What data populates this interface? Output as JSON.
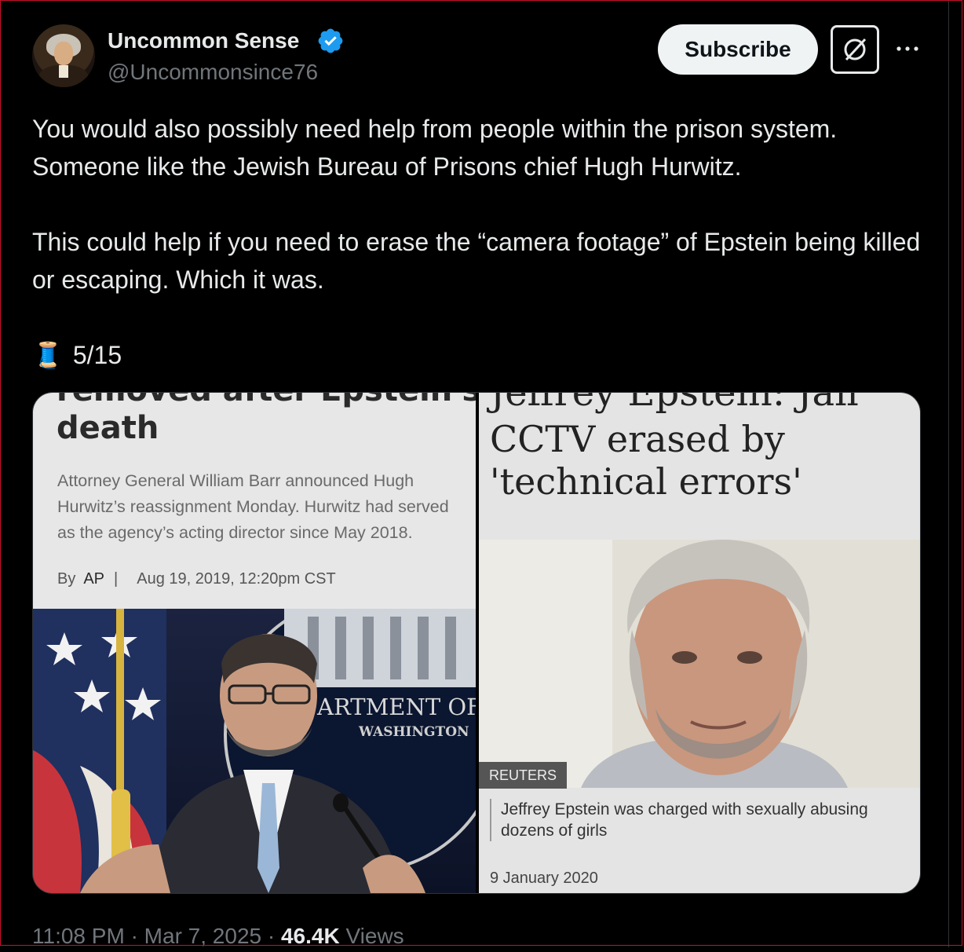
{
  "author": {
    "name": "Uncommon Sense",
    "handle": "@Uncommonsince76",
    "verified": true
  },
  "actions": {
    "subscribe_label": "Subscribe",
    "grok_icon": "grok-icon",
    "more_icon": "more-dots-icon"
  },
  "tweet": {
    "text": "You would also possibly need help from people within the prison system. Someone like the Jewish Bureau of Prisons chief Hugh Hurwitz.\n\nThis could help if you need to erase the “camera footage” of Epstein being killed or escaping. Which it was.",
    "thread_emoji": "🧵",
    "thread_count": "5/15"
  },
  "media": {
    "left": {
      "headline_cut": "removed after Epstein's",
      "headline": "death",
      "body": "Attorney General William Barr announced Hugh Hurwitz’s reassignment Monday. Hurwitz had served as the agency’s acting director since May 2018.",
      "by_label": "By",
      "author": "AP",
      "separator": "|",
      "date": "Aug 19, 2019, 12:20pm CST",
      "seal_line1": "ARTMENT OF J",
      "seal_line2": "WASHINGTON"
    },
    "right": {
      "headline_cut": "Jeffrey Epstein: Jail",
      "headline": "CCTV erased by 'technical errors'",
      "source_badge": "REUTERS",
      "caption": "Jeffrey Epstein was charged with sexually abusing dozens of girls",
      "date": "9 January 2020"
    }
  },
  "meta": {
    "time": "11:08 PM",
    "dot": "·",
    "date": "Mar 7, 2025",
    "views_count": "46.4K",
    "views_label": "Views"
  },
  "colors": {
    "background": "#000000",
    "text": "#e7e9ea",
    "muted": "#71767b",
    "verified_blue": "#1d9bf0",
    "border": "#2f3336"
  }
}
